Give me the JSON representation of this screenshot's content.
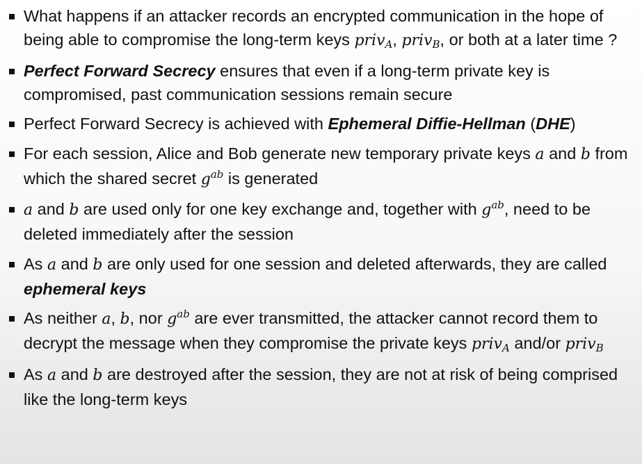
{
  "bullets": [
    {
      "parts": [
        {
          "type": "text",
          "text": "What happens if an attacker records an encrypted communication in the hope of being able to compromise the long-term keys "
        },
        {
          "type": "math",
          "base": "priv",
          "sub": "A"
        },
        {
          "type": "text",
          "text": ", "
        },
        {
          "type": "math",
          "base": "priv",
          "sub": "B"
        },
        {
          "type": "text",
          "text": ", or both at a later time ?"
        }
      ]
    },
    {
      "parts": [
        {
          "type": "term",
          "text": "Perfect Forward Secrecy"
        },
        {
          "type": "text",
          "text": " ensures that even if a long-term private key is compromised, past communication sessions remain secure"
        }
      ]
    },
    {
      "parts": [
        {
          "type": "text",
          "text": "Perfect Forward Secrecy is achieved with "
        },
        {
          "type": "term",
          "text": "Ephemeral Diffie-Hellman"
        },
        {
          "type": "text",
          "text": " ("
        },
        {
          "type": "term",
          "text": "DHE"
        },
        {
          "type": "text",
          "text": ")"
        }
      ]
    },
    {
      "parts": [
        {
          "type": "text",
          "text": "For each session, Alice and Bob generate new temporary private keys "
        },
        {
          "type": "math",
          "base": "a"
        },
        {
          "type": "text",
          "text": " and "
        },
        {
          "type": "math",
          "base": "b"
        },
        {
          "type": "text",
          "text": " from which the shared secret "
        },
        {
          "type": "math",
          "base": "g",
          "sup": "ab"
        },
        {
          "type": "text",
          "text": " is generated"
        }
      ]
    },
    {
      "parts": [
        {
          "type": "math",
          "base": "a"
        },
        {
          "type": "text",
          "text": " and "
        },
        {
          "type": "math",
          "base": "b"
        },
        {
          "type": "text",
          "text": " are used only for one key exchange and, together with "
        },
        {
          "type": "math",
          "base": "g",
          "sup": "ab"
        },
        {
          "type": "text",
          "text": ", need to be deleted immediately after the session"
        }
      ]
    },
    {
      "parts": [
        {
          "type": "text",
          "text": "As "
        },
        {
          "type": "math",
          "base": "a"
        },
        {
          "type": "text",
          "text": " and "
        },
        {
          "type": "math",
          "base": "b"
        },
        {
          "type": "text",
          "text": " are only used for one session and deleted afterwards, they are called "
        },
        {
          "type": "term",
          "text": "ephemeral keys"
        }
      ]
    },
    {
      "parts": [
        {
          "type": "text",
          "text": "As neither "
        },
        {
          "type": "math",
          "base": "a"
        },
        {
          "type": "text",
          "text": ", "
        },
        {
          "type": "math",
          "base": "b"
        },
        {
          "type": "text",
          "text": ", nor "
        },
        {
          "type": "math",
          "base": "g",
          "sup": "ab"
        },
        {
          "type": "text",
          "text": " are ever transmitted, the attacker cannot record them to decrypt the message when they compromise the private keys "
        },
        {
          "type": "math",
          "base": "priv",
          "sub": "A"
        },
        {
          "type": "text",
          "text": " and/or "
        },
        {
          "type": "math",
          "base": "priv",
          "sub": "B"
        }
      ]
    },
    {
      "parts": [
        {
          "type": "text",
          "text": "As "
        },
        {
          "type": "math",
          "base": "a"
        },
        {
          "type": "text",
          "text": " and "
        },
        {
          "type": "math",
          "base": "b"
        },
        {
          "type": "text",
          "text": " are destroyed after the session, they are not at risk of being comprised like the long-term keys"
        }
      ]
    }
  ]
}
